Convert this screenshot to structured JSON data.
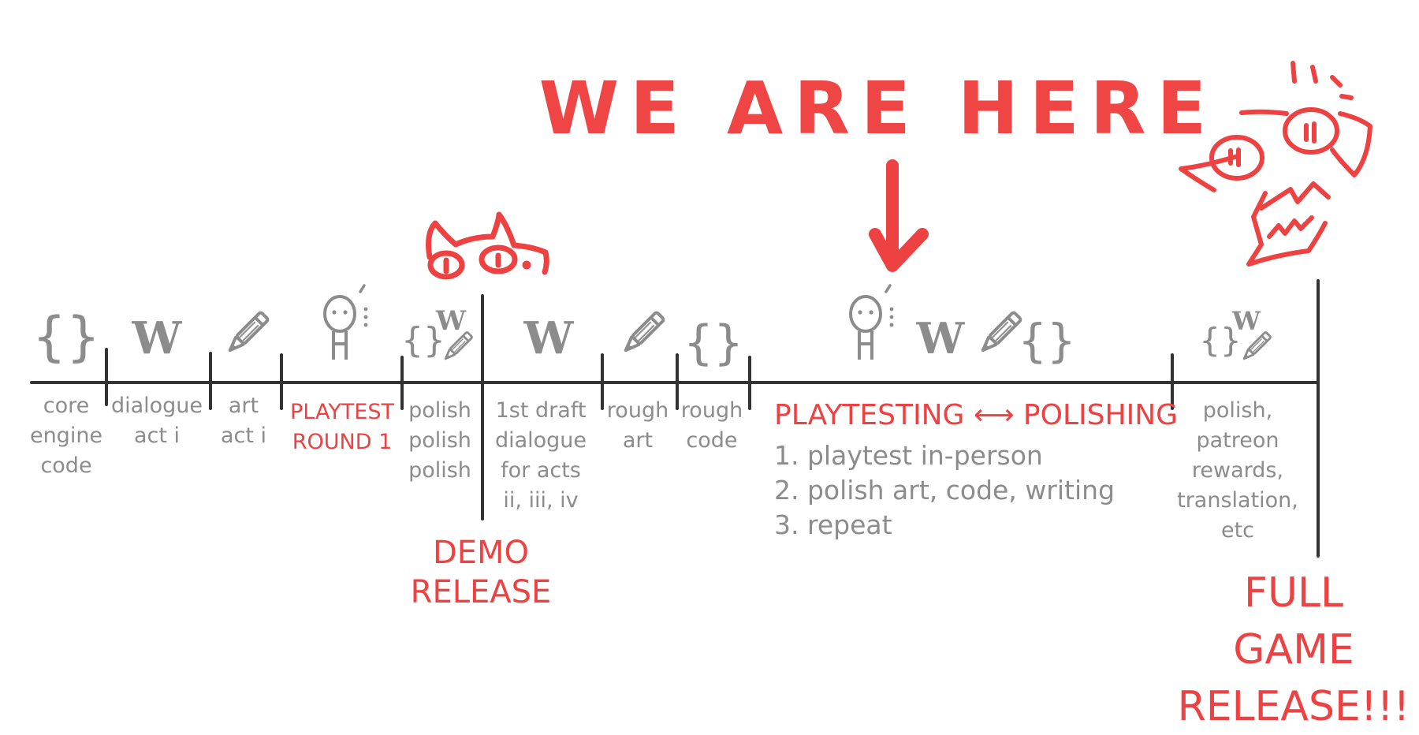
{
  "headline": "WE ARE HERE",
  "timeline_labels": {
    "core_engine_code": "core\nengine\ncode",
    "dialogue_act_i": "dialogue\nact i",
    "art_act_i": "art\nact i",
    "playtest_round_1": "PLAYTEST\nROUND 1",
    "polish_x3": "polish\npolish\npolish",
    "first_draft_dialogue": "1st draft\ndialogue\nfor acts\nii, iii, iv",
    "rough_art": "rough\nart",
    "rough_code": "rough\ncode",
    "final_polish": "polish,\npatreon\nrewards,\ntranslation,\netc"
  },
  "phase": {
    "header": "PLAYTESTING ⟷ POLISHING",
    "steps": [
      "1. playtest in-person",
      "2. polish art, code, writing",
      "3. repeat"
    ]
  },
  "milestones": {
    "demo_release": "DEMO\nRELEASE",
    "full_game_release": "FULL GAME\nRELEASE!!!"
  },
  "icon_glyphs": {
    "code_braces": "{}",
    "writing_w": "W"
  },
  "icons": [
    "code-braces-icon",
    "writing-w-icon",
    "pencil-icon",
    "playtester-figure-icon",
    "cat-mascot-icon",
    "monster-mascot-icon",
    "down-arrow-icon"
  ],
  "colors": {
    "accent_red": "#ee4141",
    "text_gray": "#8c8c8c",
    "line_dark": "#333333",
    "background": "#ffffff"
  }
}
